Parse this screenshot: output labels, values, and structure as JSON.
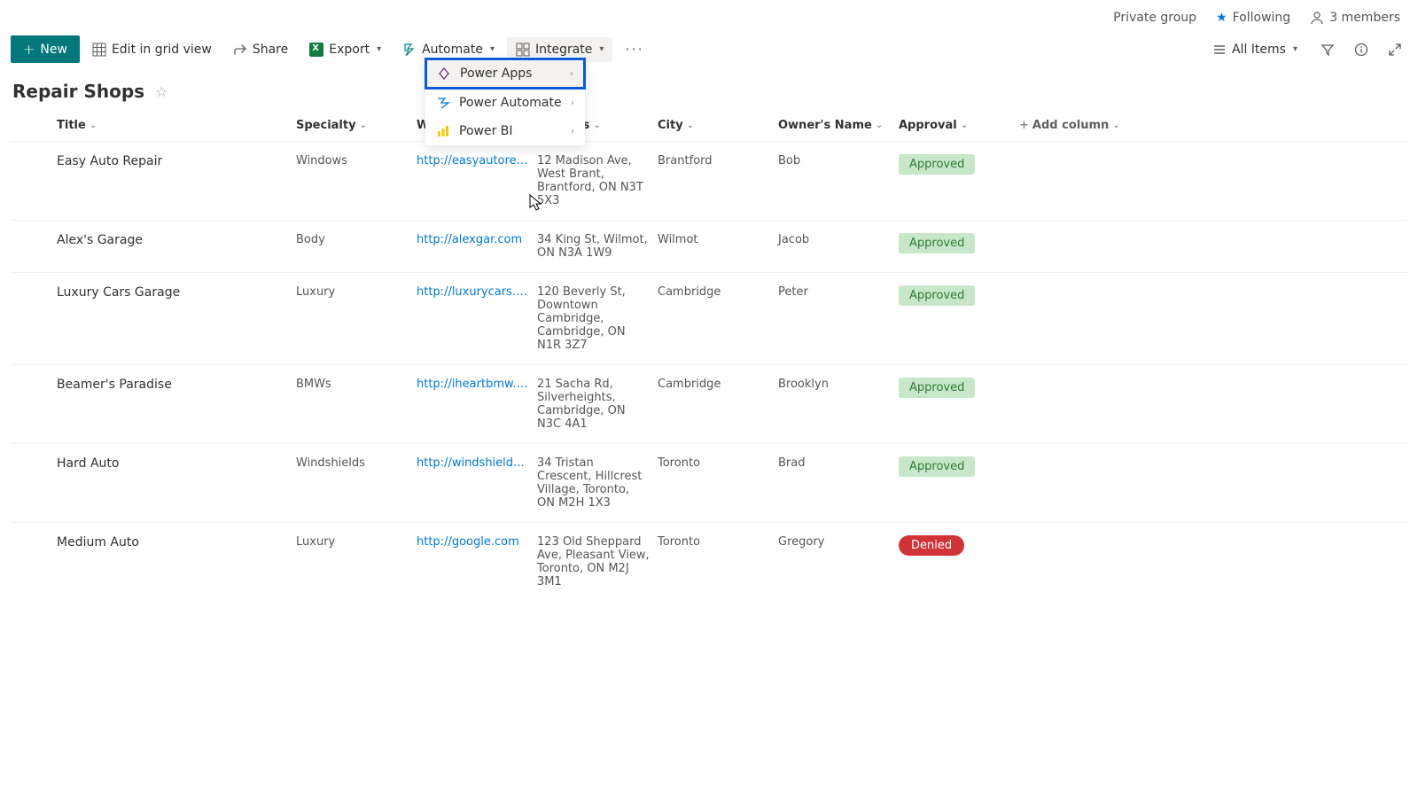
{
  "topbar": {
    "private_group": "Private group",
    "following": "Following",
    "members": "3 members"
  },
  "toolbar": {
    "new": "New",
    "edit_grid": "Edit in grid view",
    "share": "Share",
    "export": "Export",
    "automate": "Automate",
    "integrate": "Integrate",
    "all_items": "All Items"
  },
  "dropdown": {
    "power_apps": "Power Apps",
    "power_automate": "Power Automate",
    "power_bi": "Power BI"
  },
  "list": {
    "title": "Repair Shops"
  },
  "columns": {
    "title": "Title",
    "specialty": "Specialty",
    "website": "Website",
    "address": "Address",
    "city": "City",
    "owner": "Owner's Name",
    "approval": "Approval",
    "add": "Add column"
  },
  "rows": [
    {
      "title": "Easy Auto Repair",
      "specialty": "Windows",
      "website": "http://easyautorepair.c...",
      "address": "12 Madison Ave, West Brant, Brantford, ON N3T 5X3",
      "city": "Brantford",
      "owner": "Bob",
      "approval": "Approved"
    },
    {
      "title": "Alex's Garage",
      "specialty": "Body",
      "website": "http://alexgar.com",
      "address": "34 King St, Wilmot, ON N3A 1W9",
      "city": "Wilmot",
      "owner": "Jacob",
      "approval": "Approved"
    },
    {
      "title": "Luxury Cars Garage",
      "specialty": "Luxury",
      "website": "http://luxurycars.com",
      "address": "120 Beverly St, Downtown Cambridge, Cambridge, ON N1R 3Z7",
      "city": "Cambridge",
      "owner": "Peter",
      "approval": "Approved"
    },
    {
      "title": "Beamer's Paradise",
      "specialty": "BMWs",
      "website": "http://iheartbmw.com",
      "address": "21 Sacha Rd, Silverheights, Cambridge, ON N3C 4A1",
      "city": "Cambridge",
      "owner": "Brooklyn",
      "approval": "Approved"
    },
    {
      "title": "Hard Auto",
      "specialty": "Windshields",
      "website": "http://windshieldharda...",
      "address": "34 Tristan Crescent, Hillcrest Village, Toronto, ON M2H 1X3",
      "city": "Toronto",
      "owner": "Brad",
      "approval": "Approved"
    },
    {
      "title": "Medium Auto",
      "specialty": "Luxury",
      "website": "http://google.com",
      "address": "123 Old Sheppard Ave, Pleasant View, Toronto, ON M2J 3M1",
      "city": "Toronto",
      "owner": "Gregory",
      "approval": "Denied"
    }
  ]
}
